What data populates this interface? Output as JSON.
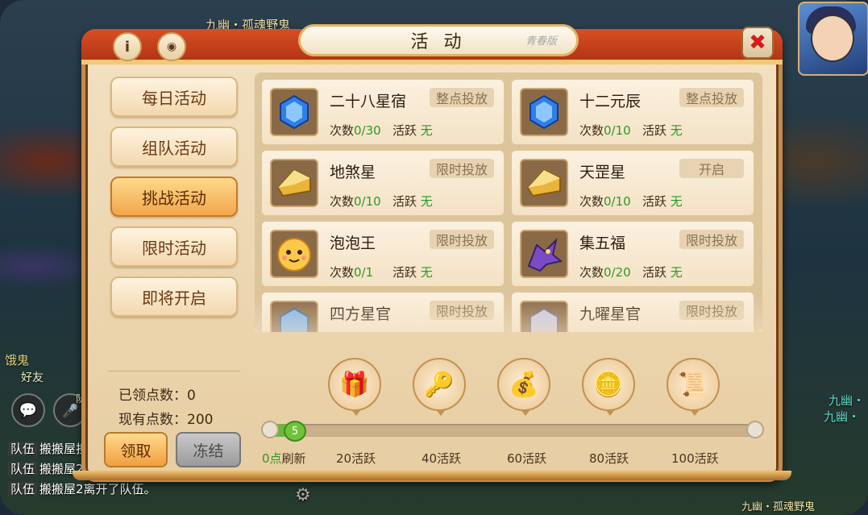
{
  "title": "活 动",
  "title_deco": "青春版",
  "close_icon": "✖",
  "info_icon": "i",
  "eye_icon": "◉",
  "nav": [
    {
      "label": "每日活动",
      "active": false
    },
    {
      "label": "组队活动",
      "active": false
    },
    {
      "label": "挑战活动",
      "active": true
    },
    {
      "label": "限时活动",
      "active": false
    },
    {
      "label": "即将开启",
      "active": false
    }
  ],
  "points": {
    "claimed_label": "已领点数：0",
    "current_label": "现有点数：200"
  },
  "buttons": {
    "claim": "领取",
    "freeze": "冻结"
  },
  "activities": [
    {
      "name": "二十八星宿",
      "tag": "整点投放",
      "count_label": "次数",
      "count": "0/30",
      "active_label": "活跃",
      "active_value": "无",
      "icon": "blue-gem-icon"
    },
    {
      "name": "十二元辰",
      "tag": "整点投放",
      "count_label": "次数",
      "count": "0/10",
      "active_label": "活跃",
      "active_value": "无",
      "icon": "blue-gem-icon"
    },
    {
      "name": "地煞星",
      "tag": "限时投放",
      "count_label": "次数",
      "count": "0/10",
      "active_label": "活跃",
      "active_value": "无",
      "icon": "gold-ingot-icon"
    },
    {
      "name": "天罡星",
      "tag": "开启",
      "count_label": "次数",
      "count": "0/10",
      "active_label": "活跃",
      "active_value": "无",
      "icon": "gold-ingot-icon"
    },
    {
      "name": "泡泡王",
      "tag": "限时投放",
      "count_label": "次数",
      "count": "0/1",
      "active_label": "活跃",
      "active_value": "无",
      "icon": "bubble-face-icon"
    },
    {
      "name": "集五福",
      "tag": "限时投放",
      "count_label": "次数",
      "count": "0/20",
      "active_label": "活跃",
      "active_value": "无",
      "icon": "purple-dragon-icon"
    },
    {
      "name": "四方星官",
      "tag": "限时投放",
      "count_label": "",
      "count": "",
      "active_label": "",
      "active_value": "",
      "icon": "blue-gem-icon"
    },
    {
      "name": "九曜星官",
      "tag": "限时投放",
      "count_label": "",
      "count": "",
      "active_label": "",
      "active_value": "",
      "icon": "silver-gem-icon"
    }
  ],
  "rewards": [
    {
      "icon": "treasure-chest-icon",
      "glyph": "🎁"
    },
    {
      "icon": "key-icon",
      "glyph": "🔑"
    },
    {
      "icon": "coin-bag-icon",
      "glyph": "💰"
    },
    {
      "icon": "gold-chest-icon",
      "glyph": "🪙"
    },
    {
      "icon": "scroll-bundle-icon",
      "glyph": "📜"
    }
  ],
  "progress": {
    "badge": "5",
    "value": 5,
    "max": 100,
    "marks": [
      {
        "prefix": "0点",
        "suffix": "刷新"
      },
      {
        "prefix": "",
        "suffix": "20活跃"
      },
      {
        "prefix": "",
        "suffix": "40活跃"
      },
      {
        "prefix": "",
        "suffix": "60活跃"
      },
      {
        "prefix": "",
        "suffix": "80活跃"
      },
      {
        "prefix": "",
        "suffix": "100活跃"
      }
    ]
  },
  "background": {
    "top_text": "九幽・孤魂野鬼",
    "left_npc": "饿鬼",
    "friend": "好友",
    "right_npc_1": "九幽・",
    "right_npc_2": "九幽・",
    "chat": [
      {
        "tag": "队伍",
        "text": "搬搬屋担"
      },
      {
        "tag": "队伍",
        "text": "搬搬屋2"
      },
      {
        "tag": "队伍",
        "text": "搬搬屋2离开了队伍。"
      }
    ],
    "bottom_right": "九幽・孤魂野鬼",
    "chat_icon": "💬",
    "mic_icon": "🎤",
    "mic_label": "队",
    "gear_icon": "⚙"
  },
  "colors": {
    "accent": "#f2a64a",
    "frame": "#c58b4a",
    "header": "#d84f24",
    "green": "#2c9a24"
  }
}
